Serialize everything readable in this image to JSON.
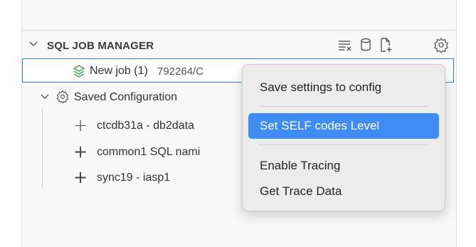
{
  "section": {
    "title": "SQL JOB MANAGER",
    "actions": [
      {
        "name": "clear-all-icon"
      },
      {
        "name": "database-icon"
      },
      {
        "name": "new-file-icon"
      },
      {
        "name": "gear-icon"
      }
    ]
  },
  "tree": {
    "job": {
      "label": "New job (1)",
      "description": "792264/C",
      "icon": "connected-db-icon"
    },
    "saved": {
      "label": "Saved Configuration",
      "icon": "gear-icon"
    },
    "configs": [
      {
        "label": "ctcdb31a - db2data"
      },
      {
        "label": "common1 SQL nami"
      },
      {
        "label": "sync19 - iasp1"
      }
    ]
  },
  "context_menu": {
    "items": [
      {
        "label": "Save settings to config",
        "highlighted": false
      },
      {
        "label": "Set SELF codes Level",
        "highlighted": true
      },
      {
        "label": "Enable Tracing",
        "highlighted": false
      },
      {
        "label": "Get Trace Data",
        "highlighted": false
      }
    ]
  },
  "colors": {
    "accent": "#3f8df4",
    "selection_border": "#3b7ad8",
    "job_icon": "#3aa65a"
  }
}
